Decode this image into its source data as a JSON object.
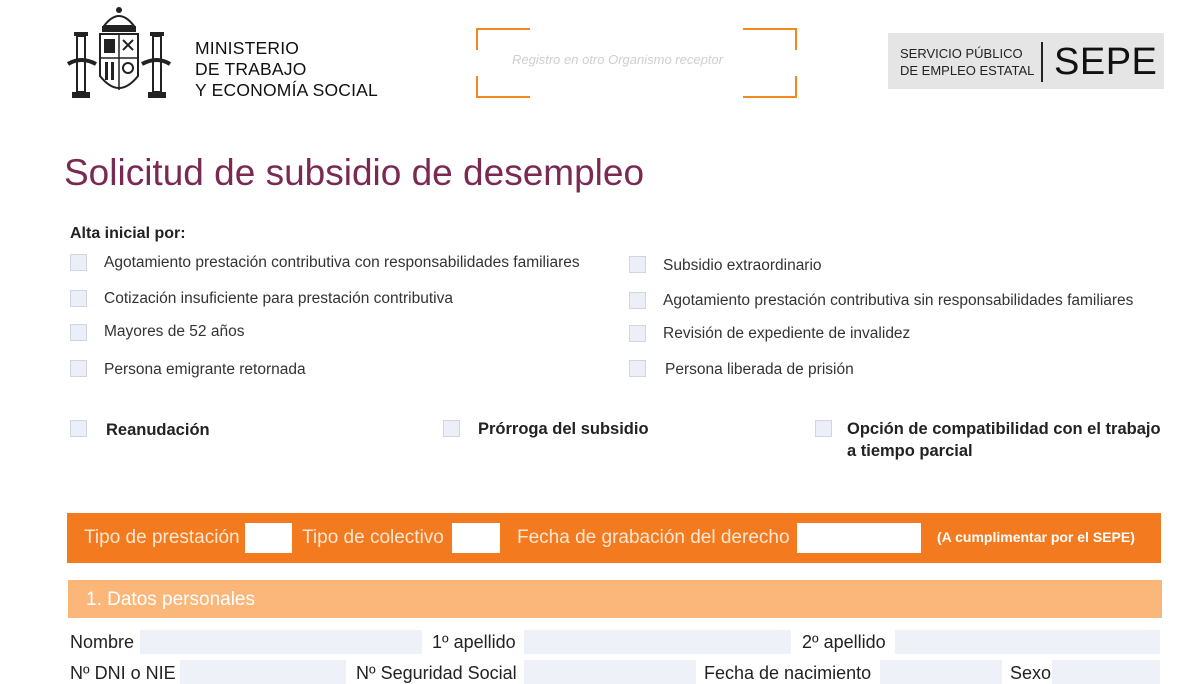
{
  "header": {
    "ministry_lines": [
      "MINISTERIO",
      "DE TRABAJO",
      "Y ECONOMÍA SOCIAL"
    ],
    "registro_placeholder": "Registro en otro Organismo receptor",
    "sepe_small_lines": [
      "SERVICIO PÚBLICO",
      "DE EMPLEO ESTATAL"
    ],
    "sepe_logo": "SEPE"
  },
  "form": {
    "title": "Solicitud de subsidio de desempleo",
    "alta_label": "Alta inicial por:",
    "left_options": [
      "Agotamiento prestación contributiva con responsabilidades familiares",
      "Cotización insuficiente para prestación contributiva",
      "Mayores de 52 años",
      "Persona emigrante retornada"
    ],
    "right_options": [
      "Subsidio extraordinario",
      "Agotamiento prestación contributiva sin responsabilidades familiares",
      "Revisión de expediente de invalidez",
      "Persona liberada de prisión"
    ],
    "reanudacion": "Reanudación",
    "prorroga": "Prórroga del subsidio",
    "opcion_line1": "Opción de compatibilidad con el trabajo",
    "opcion_line2": "a tiempo parcial"
  },
  "sepe_band": {
    "tipo_prestacion": "Tipo de prestación",
    "tipo_colectivo": "Tipo de colectivo",
    "fecha_grabacion": "Fecha de grabación del derecho",
    "note": "(A cumplimentar por el SEPE)"
  },
  "section1": {
    "title": "1. Datos personales",
    "nombre": "Nombre",
    "apellido1": "1º apellido",
    "apellido2": "2º apellido",
    "dni": "Nº DNI o NIE",
    "nss": "Nº Seguridad Social",
    "fecha_nac": "Fecha de nacimiento",
    "sexo": "Sexo"
  },
  "colors": {
    "title": "#7a2a52",
    "band": "#f47a20",
    "section": "#fbb679",
    "field": "#eef1f8"
  }
}
